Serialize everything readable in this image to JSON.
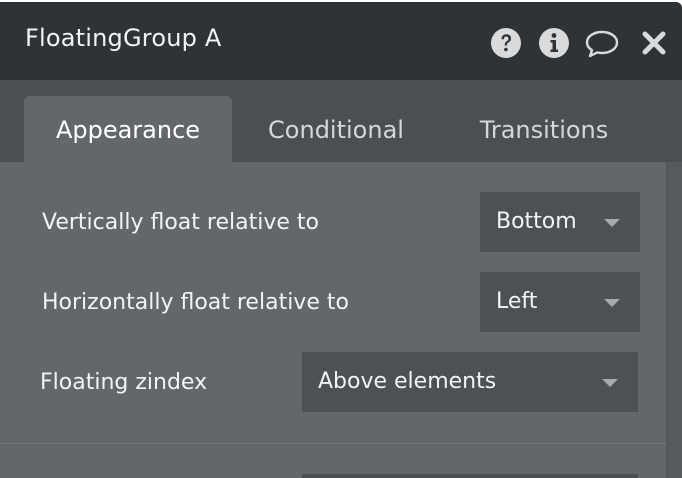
{
  "window": {
    "title": "FloatingGroup A",
    "icons": [
      "help-icon",
      "info-icon",
      "comment-icon",
      "close-icon"
    ]
  },
  "tabs": [
    {
      "label": "Appearance",
      "active": true
    },
    {
      "label": "Conditional",
      "active": false
    },
    {
      "label": "Transitions",
      "active": false
    }
  ],
  "fields": {
    "vertical_float": {
      "label": "Vertically float relative to",
      "value": "Bottom"
    },
    "horizontal_float": {
      "label": "Horizontally float relative to",
      "value": "Left"
    },
    "floating_zindex": {
      "label": "Floating zindex",
      "value": "Above elements"
    }
  },
  "colors": {
    "header_bg": "#2f3336",
    "tabbar_bg": "#4b4e52",
    "panel_bg": "#63676b",
    "dropdown_bg": "#4d5054",
    "text": "#f2f3f4"
  }
}
